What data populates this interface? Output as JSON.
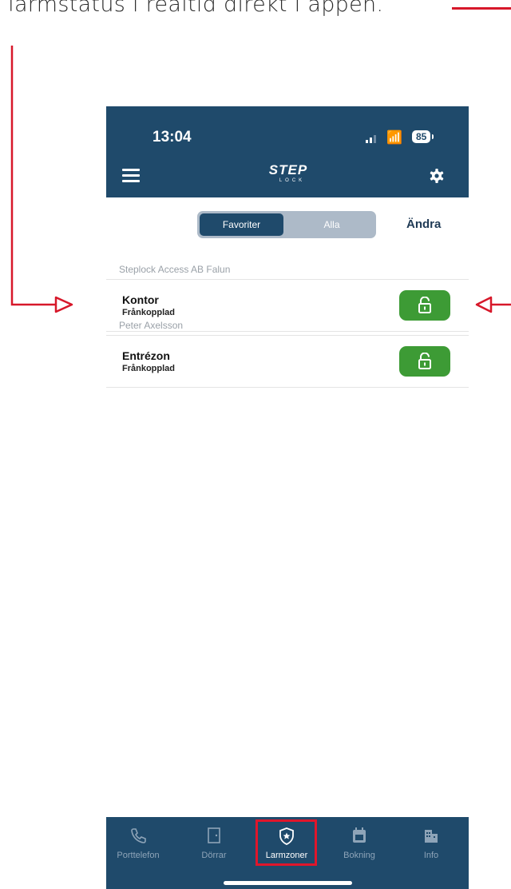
{
  "caption": "se larmstatus i realtid direkt i appen.",
  "status_bar": {
    "time": "13:04",
    "battery": "85"
  },
  "header": {
    "logo": "STEP",
    "logo_sub": "LOCK"
  },
  "tabs": {
    "favorites_label": "Favoriter",
    "all_label": "Alla",
    "selected": "Favoriter"
  },
  "edit_label": "Ändra",
  "sections": [
    {
      "title": "Steplock Access AB Falun",
      "zone": {
        "name": "Kontor",
        "status": "Frånkopplad",
        "lock_icon": "unlocked-padlock-icon"
      }
    },
    {
      "title": "Peter Axelsson",
      "zone": {
        "name": "Entrézon",
        "status": "Frånkopplad",
        "lock_icon": "unlocked-padlock-icon"
      }
    }
  ],
  "nav": [
    {
      "label": "Porttelefon",
      "icon": "phone-icon",
      "active": false
    },
    {
      "label": "Dörrar",
      "icon": "door-icon",
      "active": false
    },
    {
      "label": "Larmzoner",
      "icon": "shield-star-icon",
      "active": true
    },
    {
      "label": "Bokning",
      "icon": "calendar-icon",
      "active": false
    },
    {
      "label": "Info",
      "icon": "building-icon",
      "active": false
    }
  ],
  "colors": {
    "header_bg": "#1f4a6b",
    "lock_green": "#3d9b35",
    "annotation_red": "#d7182a"
  }
}
